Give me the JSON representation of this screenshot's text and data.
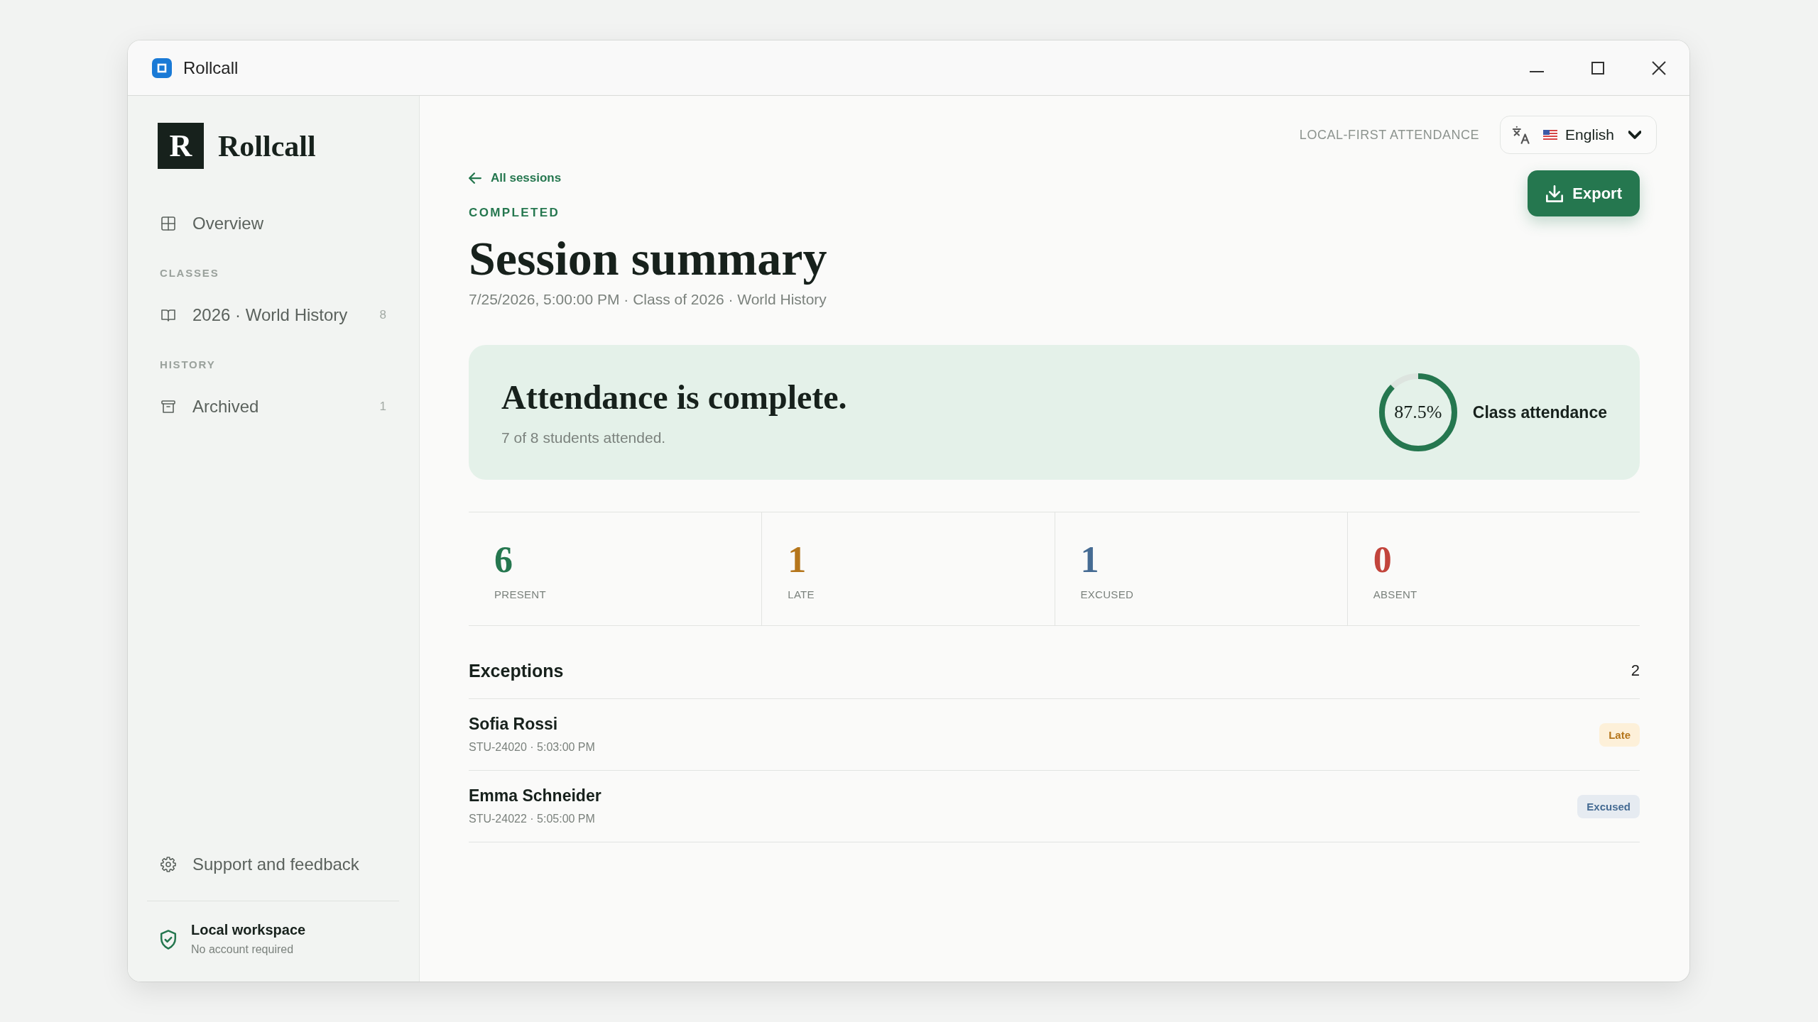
{
  "window": {
    "title": "Rollcall"
  },
  "sidebar": {
    "brand": {
      "mark": "R",
      "name": "Rollcall"
    },
    "groups": [
      {
        "items": [
          {
            "label": "Overview",
            "selected": false
          }
        ]
      },
      {
        "heading": "CLASSES",
        "items": [
          {
            "label": "2026 · World History",
            "count": "8",
            "selected": false
          }
        ]
      },
      {
        "heading": "HISTORY",
        "items": [
          {
            "label": "Archived",
            "count": "1",
            "selected": false
          }
        ]
      }
    ],
    "support": "Support and feedback",
    "workspace": {
      "title": "Local workspace",
      "subtitle": "No account required"
    }
  },
  "topbar": {
    "tagline": "LOCAL-FIRST ATTENDANCE",
    "language": "English"
  },
  "header": {
    "back_link": "All sessions",
    "status": "COMPLETED",
    "title": "Session summary",
    "meta": "7/25/2026, 5:00:00 PM · Class of 2026 · World History",
    "export_button": "Export"
  },
  "banner": {
    "heading": "Attendance is complete.",
    "detail": "7 of 8 students attended.",
    "ring": {
      "level": 0.875,
      "reading": "87.5%"
    },
    "label": "Class attendance"
  },
  "stats": [
    {
      "value": "6",
      "label": "PRESENT",
      "color": "#25774f"
    },
    {
      "value": "1",
      "label": "LATE",
      "color": "#b5761c"
    },
    {
      "value": "1",
      "label": "EXCUSED",
      "color": "#456b93"
    },
    {
      "value": "0",
      "label": "ABSENT",
      "color": "#c2443c"
    }
  ],
  "exceptions": {
    "title": "Exceptions",
    "count": "2",
    "rows": [
      {
        "name": "Sofia Rossi",
        "detail": "STU-24020 · 5:03:00 PM",
        "status": "Late",
        "kind": "late"
      },
      {
        "name": "Emma Schneider",
        "detail": "STU-24022 · 5:05:00 PM",
        "status": "Excused",
        "kind": "excused"
      }
    ]
  }
}
